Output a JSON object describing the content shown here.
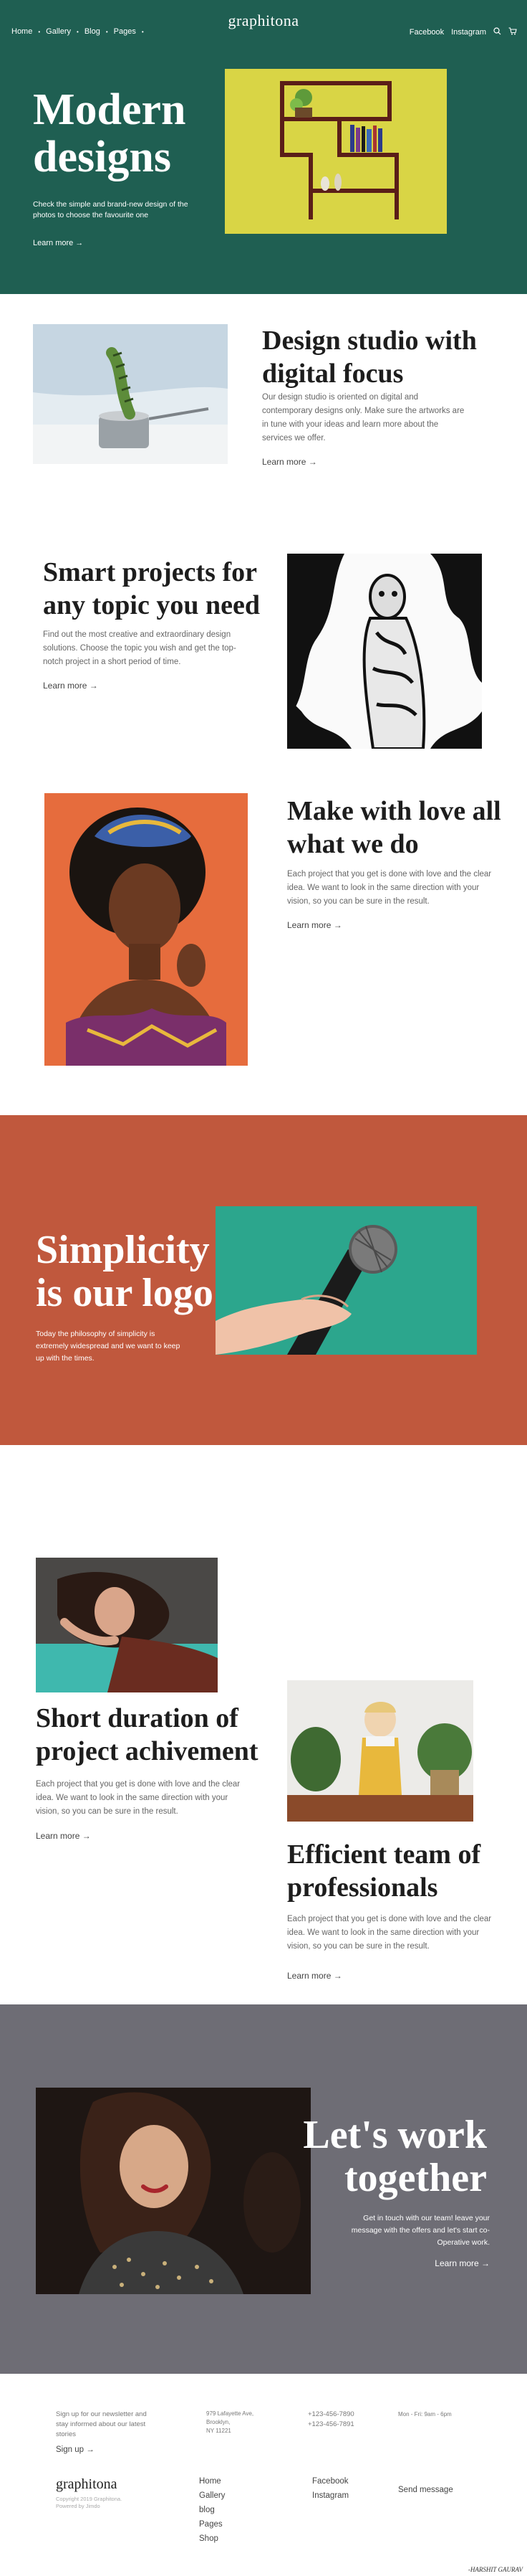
{
  "nav": {
    "left": [
      "Home",
      "Gallery",
      "Blog",
      "Pages"
    ],
    "brand": "graphitona",
    "right": [
      "Facebook",
      "Instagram"
    ]
  },
  "hero": {
    "title_line1": "Modern",
    "title_line2": "designs",
    "subtitle": "Check the simple and brand-new design of the photos to choose the favourite one",
    "link": "Learn more →",
    "bg_color": "#1f5f52",
    "image_bg": "#d9d545"
  },
  "studio": {
    "title_line1": "Design studio  with",
    "title_line2": "digital focus",
    "body": "Our design studio is oriented on digital and contemporary designs only. Make sure the artworks are in tune with your ideas and learn more about the services we offer.",
    "link": "Learn more →"
  },
  "smart": {
    "title_line1": "Smart projects for",
    "title_line2": "any topic you need",
    "body": "Find out the most creative and extraordinary design solutions. Choose the topic you wish and get  the top-notch project in a short period of time.",
    "link": "Learn more →"
  },
  "love": {
    "title_line1": "Make with love all",
    "title_line2": "what we do",
    "body": "Each project that you get is done with love and the clear idea. We want to look in the same direction with your vision, so you can be sure in the result.",
    "link": "Learn more →"
  },
  "simplicity": {
    "title_line1": "Simplicity",
    "title_line2": "is our logo",
    "body": "Today the philosophy of simplicity is extremely widespread and we want to keep up with the times.",
    "bg_color": "#c0583d",
    "image_bg": "#2aa58c"
  },
  "duration": {
    "title_line1": "Short duration of",
    "title_line2": "project achivement",
    "body": "Each project that you get is done with love and the clear idea. We want to look in the same direction with your vision, so you can be sure in the result.",
    "link": "Learn more →"
  },
  "team": {
    "title_line1": "Efficient team of",
    "title_line2": "professionals",
    "body": "Each project that you get is done with love and the clear idea. We want to look in the same direction with your vision, so you can be sure in the result.",
    "link": "Learn more →"
  },
  "work": {
    "title_line1": "Let's work",
    "title_line2": "together",
    "body": "Get in touch with our team! leave your message with the offers and let's start co-Operative work.",
    "link": "Learn more →",
    "bg_color": "#6e6d75"
  },
  "footer": {
    "newsletter": "Sign up for our newsletter and stay informed about our latest stories",
    "signup": "Sign up →",
    "address_line1": "979 Lafayette Ave,",
    "address_line2": "Brooklyn,",
    "address_line3": "NY 11221",
    "phone1": "+123-456-7890",
    "phone2": "+123-456-7891",
    "hours": "Mon - Fri: 9am - 6pm",
    "brand": "graphitona",
    "copyright_line1": "Copyright 2019 Graphitona.",
    "copyright_line2": "Powered by Jimdo",
    "links": [
      "Home",
      "Gallery",
      "blog",
      "Pages",
      "Shop"
    ],
    "social": [
      "Facebook",
      "Instagram"
    ],
    "send": "Send message"
  },
  "signature": "-HARSHIT GAURAV"
}
